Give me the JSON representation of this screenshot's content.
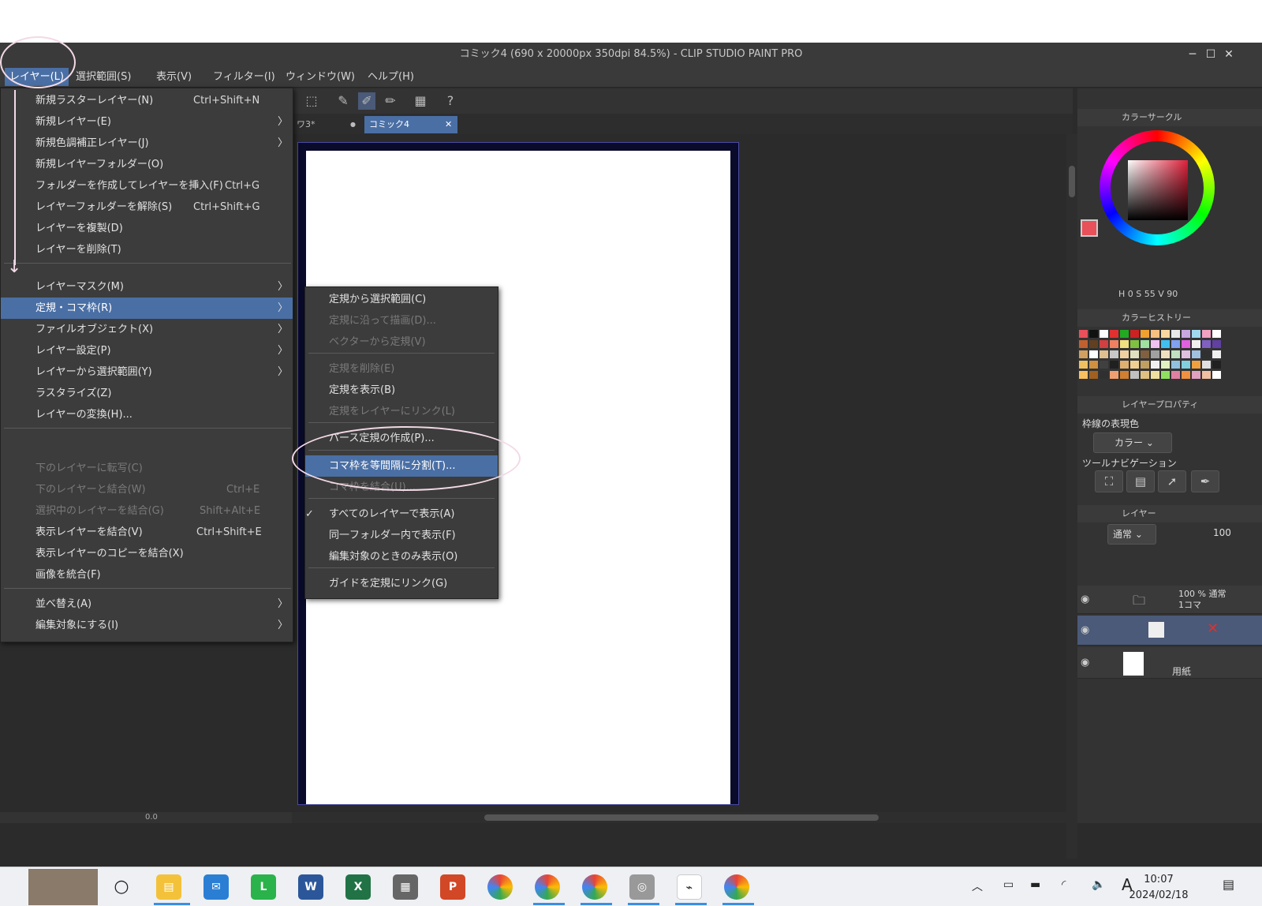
{
  "window": {
    "title": "コミック4 (690 x 20000px 350dpi 84.5%)  - CLIP STUDIO PAINT PRO",
    "minimize": "─",
    "maximize": "☐",
    "close": "✕"
  },
  "menubar": {
    "items": [
      "レイヤー(L)",
      "選択範囲(S)",
      "表示(V)",
      "フィルター(I)",
      "ウィンドウ(W)",
      "ヘルプ(H)"
    ]
  },
  "tabs": {
    "tab1": "ワ3*",
    "tab1_dot": "●",
    "tab2": "コミック4",
    "tab2_close": "✕"
  },
  "layer_menu": {
    "group1": [
      {
        "label": "新規ラスターレイヤー(N)",
        "shortcut": "Ctrl+Shift+N"
      },
      {
        "label": "新規レイヤー(E)",
        "arrow": "〉"
      },
      {
        "label": "新規色調補正レイヤー(J)",
        "arrow": "〉"
      },
      {
        "label": "新規レイヤーフォルダー(O)"
      },
      {
        "label": "フォルダーを作成してレイヤーを挿入(F)",
        "shortcut": "Ctrl+G"
      },
      {
        "label": "レイヤーフォルダーを解除(S)",
        "shortcut": "Ctrl+Shift+G"
      },
      {
        "label": "レイヤーを複製(D)"
      },
      {
        "label": "レイヤーを削除(T)"
      }
    ],
    "group2": [
      {
        "label": "レイヤーマスク(M)",
        "arrow": "〉"
      },
      {
        "label": "定規・コマ枠(R)",
        "arrow": "〉"
      },
      {
        "label": "ファイルオブジェクト(X)",
        "arrow": "〉"
      },
      {
        "label": "レイヤー設定(P)",
        "arrow": "〉"
      },
      {
        "label": "レイヤーから選択範囲(Y)",
        "arrow": "〉"
      },
      {
        "label": "ラスタライズ(Z)"
      },
      {
        "label": "レイヤーの変換(H)..."
      }
    ],
    "group3": [
      {
        "label": "下のレイヤーに転写(C)"
      },
      {
        "label": "下のレイヤーと結合(W)",
        "shortcut": "Ctrl+E"
      },
      {
        "label": "選択中のレイヤーを結合(G)",
        "shortcut": "Shift+Alt+E"
      },
      {
        "label": "表示レイヤーを結合(V)",
        "shortcut": "Ctrl+Shift+E"
      },
      {
        "label": "表示レイヤーのコピーを結合(X)"
      },
      {
        "label": "画像を統合(F)"
      }
    ],
    "group4": [
      {
        "label": "並べ替え(A)",
        "arrow": "〉"
      },
      {
        "label": "編集対象にする(I)",
        "arrow": "〉"
      }
    ]
  },
  "ruler_submenu": {
    "items": [
      {
        "label": "定規から選択範囲(C)"
      },
      {
        "label": "定規に沿って描画(D)..."
      },
      {
        "label": "ベクターから定規(V)"
      },
      {
        "label": "定規を削除(E)"
      },
      {
        "label": "定規を表示(B)"
      },
      {
        "label": "定規をレイヤーにリンク(L)"
      },
      {
        "label": "パース定規の作成(P)..."
      },
      {
        "label": "コマ枠を等間隔に分割(T)..."
      },
      {
        "label": "コマ枠を結合(U)..."
      },
      {
        "label": "すべてのレイヤーで表示(A)",
        "check": "✓"
      },
      {
        "label": "同一フォルダー内で表示(F)"
      },
      {
        "label": "編集対象のときのみ表示(O)"
      },
      {
        "label": "ガイドを定規にリンク(G)"
      }
    ]
  },
  "right_panel": {
    "color_circle_title": "カラーサークル",
    "hsv": {
      "h_label": "H",
      "h": "0",
      "s_label": "S",
      "s": "55",
      "v_label": "V",
      "v": "90"
    },
    "color_history_title": "カラーヒストリー",
    "layer_property_title": "レイヤープロパティ",
    "border_color_label": "枠線の表現色",
    "border_color_value": "カラー",
    "tool_nav_label": "ツールナビゲーション",
    "layer_title": "レイヤー",
    "blend_mode": "通常",
    "opacity": "100",
    "folder_layer": {
      "line1": "100 % 通常",
      "line2": "1コマ"
    },
    "paper_layer": "用紙"
  },
  "status": {
    "zoom": "0.0"
  },
  "taskbar": {
    "time": "10:07",
    "date": "2024/02/18",
    "ime": "A"
  },
  "colors": {
    "accent": "#4a6fa5",
    "annotation": "#f3d9e6"
  }
}
